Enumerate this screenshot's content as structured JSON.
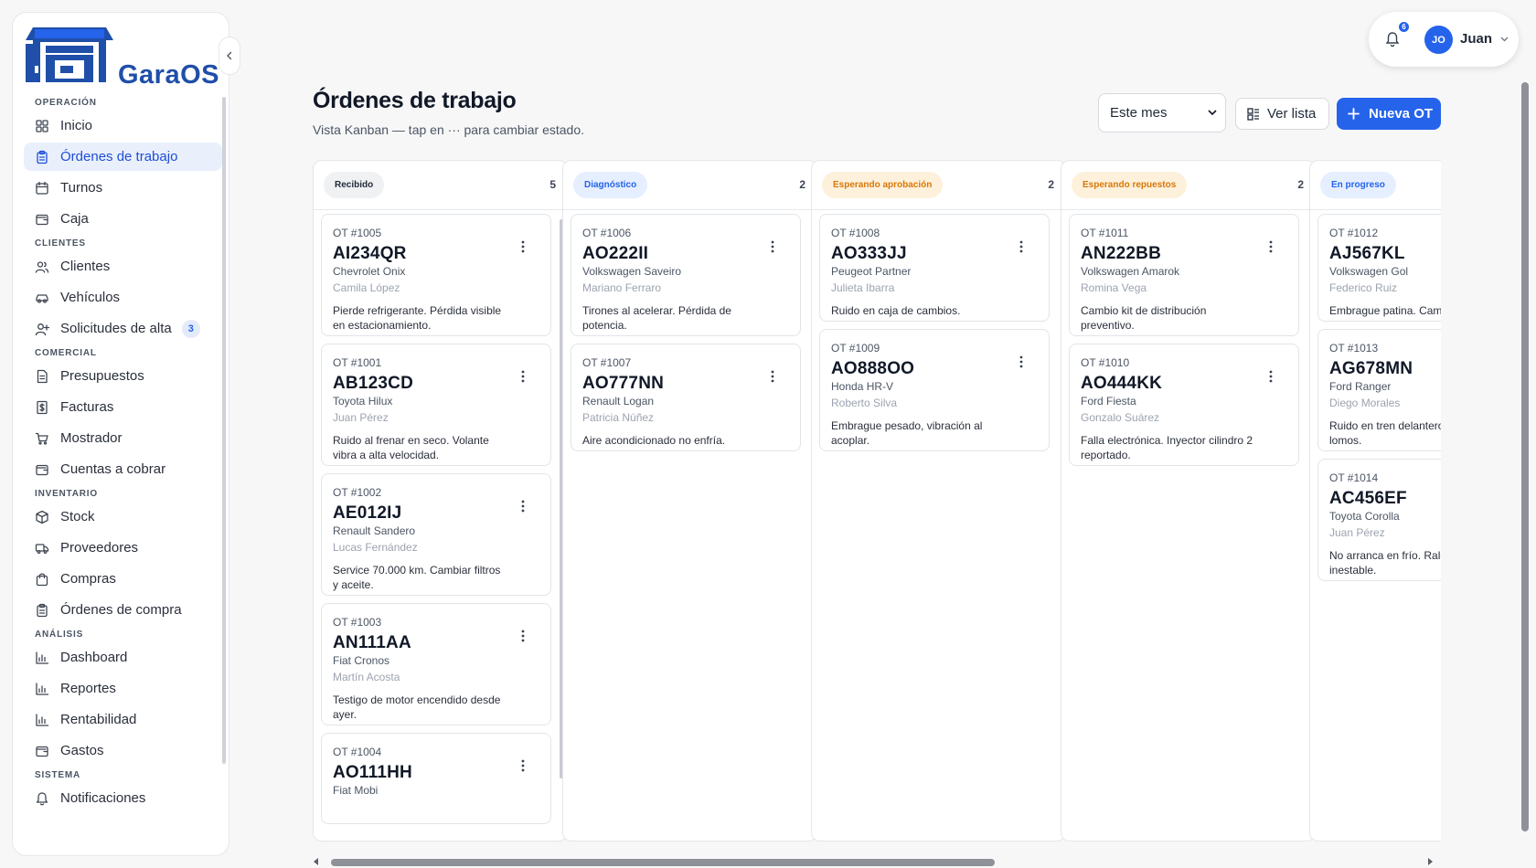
{
  "app": {
    "name": "GaraOS"
  },
  "sidebar": {
    "sections": [
      {
        "title": "OPERACIÓN",
        "items": [
          {
            "label": "Inicio",
            "icon": "grid-icon"
          },
          {
            "label": "Órdenes de trabajo",
            "icon": "clipboard-icon",
            "active": true
          },
          {
            "label": "Turnos",
            "icon": "calendar-icon"
          },
          {
            "label": "Caja",
            "icon": "wallet-icon"
          }
        ]
      },
      {
        "title": "CLIENTES",
        "items": [
          {
            "label": "Clientes",
            "icon": "users-icon"
          },
          {
            "label": "Vehículos",
            "icon": "car-icon"
          },
          {
            "label": "Solicitudes de alta",
            "icon": "user-plus-icon",
            "badge": "3"
          }
        ]
      },
      {
        "title": "COMERCIAL",
        "items": [
          {
            "label": "Presupuestos",
            "icon": "document-icon"
          },
          {
            "label": "Facturas",
            "icon": "invoice-icon"
          },
          {
            "label": "Mostrador",
            "icon": "cart-icon"
          },
          {
            "label": "Cuentas a cobrar",
            "icon": "wallet-icon"
          }
        ]
      },
      {
        "title": "INVENTARIO",
        "items": [
          {
            "label": "Stock",
            "icon": "box-icon"
          },
          {
            "label": "Proveedores",
            "icon": "truck-icon"
          },
          {
            "label": "Compras",
            "icon": "bag-icon"
          },
          {
            "label": "Órdenes de compra",
            "icon": "clipboard-icon"
          }
        ]
      },
      {
        "title": "ANÁLISIS",
        "items": [
          {
            "label": "Dashboard",
            "icon": "bar-chart-icon"
          },
          {
            "label": "Reportes",
            "icon": "bar-chart-icon"
          },
          {
            "label": "Rentabilidad",
            "icon": "bar-chart-icon"
          },
          {
            "label": "Gastos",
            "icon": "wallet-icon"
          }
        ]
      },
      {
        "title": "SISTEMA",
        "items": [
          {
            "label": "Notificaciones",
            "icon": "bell-icon"
          }
        ]
      }
    ]
  },
  "user": {
    "initials": "JO",
    "name": "Juan",
    "notification_count": "6"
  },
  "header": {
    "title": "Órdenes de trabajo",
    "subtitle": "Vista Kanban — tap en ··· para cambiar estado.",
    "period": "Este mes",
    "list_button": "Ver lista",
    "new_button": "Nueva OT"
  },
  "columns": [
    {
      "label": "Recibido",
      "count": "5",
      "pill_bg": "#f0f1f3",
      "pill_fg": "#1f2937",
      "cards": [
        {
          "ot": "OT #1005",
          "plate": "AI234QR",
          "model": "Chevrolet Onix",
          "client": "Camila López",
          "desc": "Pierde refrigerante. Pérdida visible en estacionamiento."
        },
        {
          "ot": "OT #1001",
          "plate": "AB123CD",
          "model": "Toyota Hilux",
          "client": "Juan Pérez",
          "desc": "Ruido al frenar en seco. Volante vibra a alta velocidad."
        },
        {
          "ot": "OT #1002",
          "plate": "AE012IJ",
          "model": "Renault Sandero",
          "client": "Lucas Fernández",
          "desc": "Service 70.000 km. Cambiar filtros y aceite."
        },
        {
          "ot": "OT #1003",
          "plate": "AN111AA",
          "model": "Fiat Cronos",
          "client": "Martín Acosta",
          "desc": "Testigo de motor encendido desde ayer."
        },
        {
          "ot": "OT #1004",
          "plate": "AO111HH",
          "model": "Fiat Mobi",
          "client": "",
          "desc": ""
        }
      ]
    },
    {
      "label": "Diagnóstico",
      "count": "2",
      "pill_bg": "#e6efff",
      "pill_fg": "#2563eb",
      "cards": [
        {
          "ot": "OT #1006",
          "plate": "AO222II",
          "model": "Volkswagen Saveiro",
          "client": "Mariano Ferraro",
          "desc": "Tirones al acelerar. Pérdida de potencia."
        },
        {
          "ot": "OT #1007",
          "plate": "AO777NN",
          "model": "Renault Logan",
          "client": "Patricia Núñez",
          "desc": "Aire acondicionado no enfría."
        }
      ]
    },
    {
      "label": "Esperando aprobación",
      "count": "2",
      "pill_bg": "#fdf1dc",
      "pill_fg": "#d97706",
      "cards": [
        {
          "ot": "OT #1008",
          "plate": "AO333JJ",
          "model": "Peugeot Partner",
          "client": "Julieta Ibarra",
          "desc": "Ruido en caja de cambios."
        },
        {
          "ot": "OT #1009",
          "plate": "AO888OO",
          "model": "Honda HR-V",
          "client": "Roberto Silva",
          "desc": "Embrague pesado, vibración al acoplar."
        }
      ]
    },
    {
      "label": "Esperando repuestos",
      "count": "2",
      "pill_bg": "#fdf1dc",
      "pill_fg": "#d97706",
      "cards": [
        {
          "ot": "OT #1011",
          "plate": "AN222BB",
          "model": "Volkswagen Amarok",
          "client": "Romina Vega",
          "desc": "Cambio kit de distribución preventivo."
        },
        {
          "ot": "OT #1010",
          "plate": "AO444KK",
          "model": "Ford Fiesta",
          "client": "Gonzalo Suárez",
          "desc": "Falla electrónica. Inyector cilindro 2 reportado."
        }
      ]
    },
    {
      "label": "En progreso",
      "count": "",
      "pill_bg": "#e6efff",
      "pill_fg": "#2563eb",
      "cards": [
        {
          "ot": "OT #1012",
          "plate": "AJ567KL",
          "model": "Volkswagen Gol",
          "client": "Federico Ruiz",
          "desc": "Embrague patina. Cambio de kit."
        },
        {
          "ot": "OT #1013",
          "plate": "AG678MN",
          "model": "Ford Ranger",
          "client": "Diego Morales",
          "desc": "Ruido en tren delantero al pasar lomos."
        },
        {
          "ot": "OT #1014",
          "plate": "AC456EF",
          "model": "Toyota Corolla",
          "client": "Juan Pérez",
          "desc": "No arranca en frío. Ralentí inestable."
        }
      ]
    }
  ]
}
